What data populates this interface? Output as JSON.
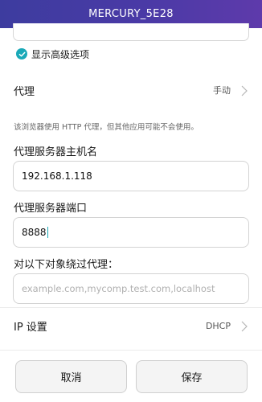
{
  "window": {
    "title": "MERCURY_5E28"
  },
  "advanced": {
    "checkbox_label": "显示高级选项",
    "checked": true
  },
  "proxy": {
    "title": "代理",
    "value": "手动",
    "hint": "该浏览器使用 HTTP 代理，但其他应用可能不会使用。"
  },
  "hostname": {
    "label": "代理服务器主机名",
    "value": "192.168.1.118"
  },
  "port": {
    "label": "代理服务器端口",
    "value": "8888"
  },
  "bypass": {
    "label": "对以下对象绕过代理：",
    "placeholder": "example.com,mycomp.test.com,localhost"
  },
  "ip": {
    "title": "IP 设置",
    "value": "DHCP"
  },
  "buttons": {
    "cancel": "取消",
    "save": "保存"
  },
  "colors": {
    "accent": "#1aa9b8",
    "titlebar_start": "#3d3c9f",
    "titlebar_end": "#5e3aab"
  },
  "icons": {
    "check": "check-icon",
    "chevron": "chevron-right-icon"
  }
}
